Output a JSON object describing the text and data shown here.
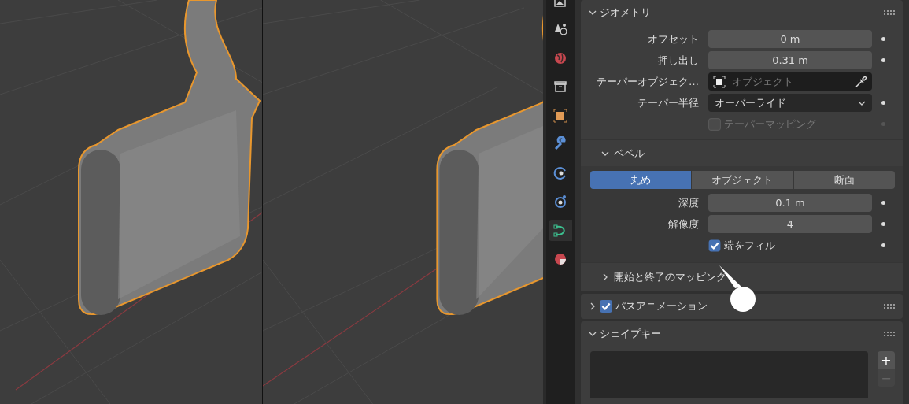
{
  "tabs": [
    {
      "kind": "image",
      "selected": false
    },
    {
      "kind": "physics",
      "selected": false
    },
    {
      "kind": "world",
      "selected": false
    },
    {
      "kind": "collection",
      "selected": false
    },
    {
      "kind": "object",
      "selected": false
    },
    {
      "kind": "modifier",
      "selected": false
    },
    {
      "kind": "constraint",
      "selected": false
    },
    {
      "kind": "particles",
      "selected": false
    },
    {
      "kind": "curve",
      "selected": true
    },
    {
      "kind": "material",
      "selected": false
    }
  ],
  "geometry": {
    "title": "ジオメトリ",
    "expanded": true,
    "rows": [
      {
        "kind": "number",
        "label": "オフセット",
        "value": "0 m"
      },
      {
        "kind": "number",
        "label": "押し出し",
        "value": "0.31 m"
      },
      {
        "kind": "object",
        "label": "テーパーオブジェク…",
        "placeholder": "オブジェクト"
      },
      {
        "kind": "dropdown",
        "label": "テーパー半径",
        "value": "オーバーライド"
      },
      {
        "kind": "checkbox",
        "label": "テーパーマッピング",
        "checked": false,
        "disabled": true
      }
    ],
    "bevel": {
      "title": "ベベル",
      "expanded": true,
      "modes": [
        {
          "label": "丸め",
          "selected": true
        },
        {
          "label": "オブジェクト",
          "selected": false
        },
        {
          "label": "断面",
          "selected": false
        }
      ],
      "rows": [
        {
          "kind": "number",
          "label": "深度",
          "value": "0.1 m"
        },
        {
          "kind": "number",
          "label": "解像度",
          "value": "4"
        },
        {
          "kind": "checkbox",
          "label": "端をフィル",
          "checked": true,
          "disabled": false
        }
      ]
    },
    "mapping": {
      "title": "開始と終了のマッピング",
      "expanded": false
    }
  },
  "path_animation": {
    "title": "パスアニメーション",
    "expanded": false,
    "checked": true
  },
  "shape_keys": {
    "title": "シェイプキー",
    "expanded": true,
    "buttons": [
      {
        "label": "+",
        "disabled": false
      },
      {
        "label": "−",
        "disabled": true
      }
    ]
  }
}
